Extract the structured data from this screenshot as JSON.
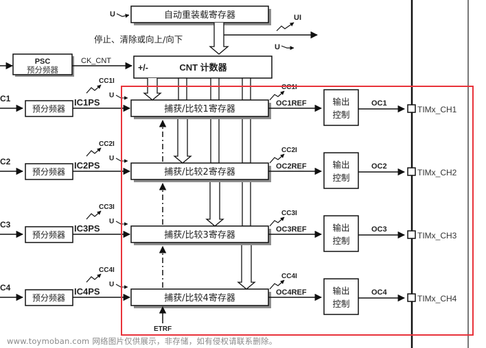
{
  "colors": {
    "stroke": "#111111",
    "shadow": "#8c8c8c",
    "text": "#222222",
    "highlight": "#e8323a",
    "watermark": "#8a8a8a",
    "rail2": "#777777"
  },
  "top": {
    "arr_label": "自动重装载寄存器",
    "arr_update": "U",
    "control_label": "停止、清除或向上/向下",
    "ui_label": "UI",
    "u_out_label": "U",
    "psc_title": "PSC",
    "psc_sub": "预分频器",
    "ck_cnt": "CK_CNT",
    "cnt_sign": "+/-",
    "cnt_label": "CNT 计数器"
  },
  "channels": [
    {
      "input": "C1",
      "prescaler": "预分频器",
      "icps": "IC1PS",
      "cci": "CC1I",
      "u": "U",
      "register": "捕获/比较1寄存器",
      "ocref": "OC1REF",
      "ocref_irq": "CC1I",
      "output_ctrl_1": "输出",
      "output_ctrl_2": "控制",
      "oc": "OC1",
      "pin": "TIMx_CH1"
    },
    {
      "input": "C2",
      "prescaler": "预分频器",
      "icps": "IC2PS",
      "cci": "CC2I",
      "u": "U",
      "register": "捕获/比较2寄存器",
      "ocref": "OC2REF",
      "ocref_irq": "CC2I",
      "output_ctrl_1": "输出",
      "output_ctrl_2": "控制",
      "oc": "OC2",
      "pin": "TIMx_CH2"
    },
    {
      "input": "C3",
      "prescaler": "预分频器",
      "icps": "IC3PS",
      "cci": "CC3I",
      "u": "U",
      "register": "捕获/比较3寄存器",
      "ocref": "OC3REF",
      "ocref_irq": "CC3I",
      "output_ctrl_1": "输出",
      "output_ctrl_2": "控制",
      "oc": "OC3",
      "pin": "TIMx_CH3"
    },
    {
      "input": "C4",
      "prescaler": "预分频器",
      "icps": "IC4PS",
      "cci": "CC4I",
      "u": "U",
      "register": "捕获/比较4寄存器",
      "ocref": "OC4REF",
      "ocref_irq": "CC4I",
      "output_ctrl_1": "输出",
      "output_ctrl_2": "控制",
      "oc": "OC4",
      "pin": "TIMx_CH4"
    }
  ],
  "etrf": "ETRF",
  "watermark": "www.toymoban.com 网络图片仅供展示，非存储，如有侵权请联系删除。"
}
